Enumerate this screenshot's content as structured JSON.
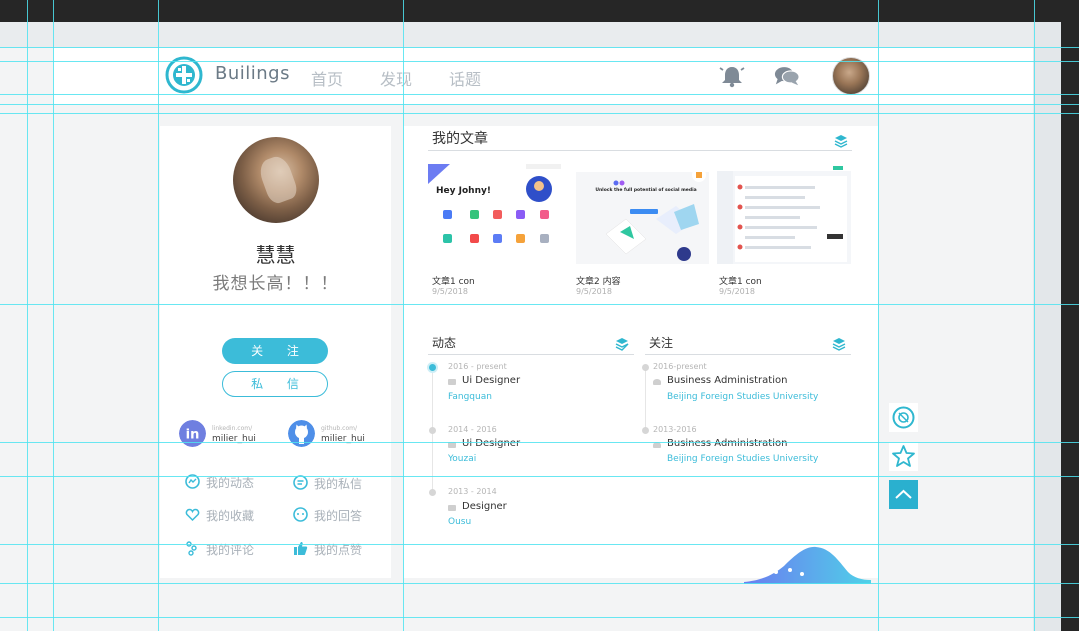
{
  "header": {
    "brand": "Builings",
    "nav": [
      "首页",
      "发现",
      "话题"
    ],
    "icons": [
      "bell-icon",
      "chat-icon"
    ]
  },
  "profile": {
    "name": "慧慧",
    "motto": "我想长高！！！",
    "follow_label": "关 注",
    "message_label": "私 信",
    "social": [
      {
        "site": "linkedin.com/",
        "user": "milier_hui",
        "icon": "linkedin-icon"
      },
      {
        "site": "github.com/",
        "user": "milier_hui",
        "icon": "github-icon"
      }
    ],
    "menu": [
      {
        "label": "我的动态",
        "icon": "activity-icon"
      },
      {
        "label": "我的私信",
        "icon": "message-icon"
      },
      {
        "label": "我的收藏",
        "icon": "heart-icon"
      },
      {
        "label": "我的回答",
        "icon": "answer-icon"
      },
      {
        "label": "我的评论",
        "icon": "comment-icon"
      },
      {
        "label": "我的点赞",
        "icon": "thumbs-up-icon"
      }
    ]
  },
  "articles": {
    "title": "我的文章",
    "items": [
      {
        "title": "文章1 con",
        "date": "9/5/2018",
        "thumb_text": "Hey Johny!"
      },
      {
        "title": "文章2 内容",
        "date": "9/5/2018",
        "thumb_text": "Unlock the full potential of social media"
      },
      {
        "title": "文章1 con",
        "date": "9/5/2018",
        "thumb_text": ""
      }
    ]
  },
  "activity": {
    "title": "动态",
    "entries": [
      {
        "period": "2016 - present",
        "role": "Ui Designer",
        "org": "Fangquan"
      },
      {
        "period": "2014 - 2016",
        "role": "Ui Designer",
        "org": "Youzai"
      },
      {
        "period": "2013 - 2014",
        "role": "Designer",
        "org": "Ousu"
      }
    ]
  },
  "following": {
    "title": "关注",
    "entries": [
      {
        "period": "2016-present",
        "role": "Business Administration",
        "org": "Beijing Foreign Studies University"
      },
      {
        "period": "2013-2016",
        "role": "Business Administration",
        "org": "Beijing Foreign Studies University"
      }
    ]
  },
  "colors": {
    "accent": "#3cbcd9",
    "background": "#f3f4f5",
    "dark_frame": "#262626"
  }
}
